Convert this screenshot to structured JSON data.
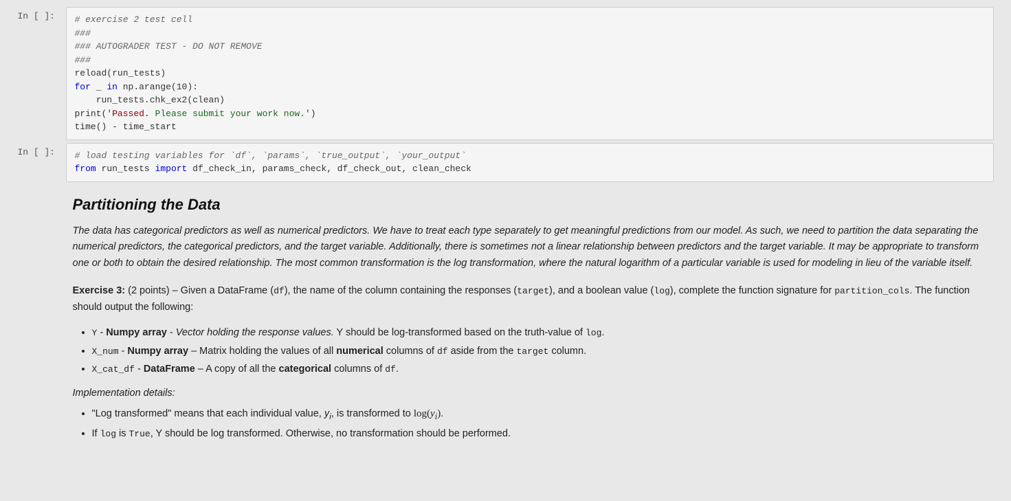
{
  "cells": [
    {
      "label": "In [ ]:",
      "lines": [
        {
          "text": "# exercise 2 test cell",
          "type": "comment"
        },
        {
          "text": "###",
          "type": "comment"
        },
        {
          "text": "### AUTOGRADER TEST - DO NOT REMOVE",
          "type": "comment"
        },
        {
          "text": "###",
          "type": "comment"
        },
        {
          "text": "reload(run_tests)",
          "type": "code"
        },
        {
          "text": "for _ in np.arange(10):",
          "type": "code"
        },
        {
          "text": "    run_tests.chk_ex2(clean)",
          "type": "code"
        },
        {
          "text": "print('Passed. Please submit your work now.')",
          "type": "print"
        },
        {
          "text": "time() - time_start",
          "type": "code"
        }
      ]
    },
    {
      "label": "In [ ]:",
      "lines": [
        {
          "text": "# load testing variables for `df`, `params`, `true_output`, `your_output`",
          "type": "comment"
        },
        {
          "text": "from run_tests import df_check_in, params_check, df_check_out, clean_check",
          "type": "code"
        }
      ]
    }
  ],
  "markdown": {
    "title": "Partitioning the Data",
    "intro": "The data has categorical predictors as well as numerical predictors. We have to treat each type separately to get meaningful predictions from our model. As such, we need to partition the data separating the numerical predictors, the categorical predictors, and the target variable. Additionally, there is sometimes not a linear relationship between predictors and the target variable. It may be appropriate to transform one or both to obtain the desired relationship. The most common transformation is the log transformation, where the natural logarithm of a particular variable is used for modeling in lieu of the variable itself.",
    "exercise_label": "Exercise 3:",
    "exercise_points": " (2 points) – Given a DataFrame (df), the name of the column containing the responses (target), and a boolean value (log), complete the function signature for partition_cols. The function should output the following:",
    "bullets": [
      "Y - Numpy array - Vector holding the response values. Y should be log-transformed based on the truth-value of log.",
      "X_num - Numpy array - Matrix holding the values of all numerical columns of df aside from the target column.",
      "X_cat_df - DataFrame - A copy of all the categorical columns of df."
    ],
    "impl_header": "Implementation details:",
    "impl_bullets": [
      "\"Log transformed\" means that each individual value, yi, is transformed to log(yi).",
      "If log is True, Y should be log transformed. Otherwise, no transformation should be performed."
    ]
  }
}
